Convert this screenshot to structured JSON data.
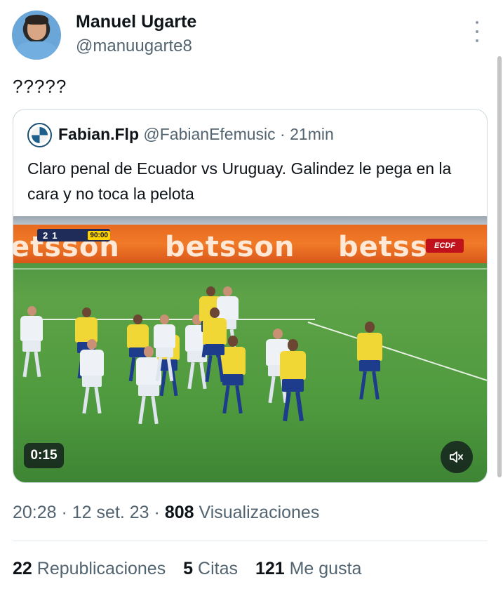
{
  "author": {
    "name": "Manuel Ugarte",
    "handle": "@manuugarte8"
  },
  "tweet": {
    "text": "?????"
  },
  "quoted": {
    "name": "Fabian.Flp",
    "handle": "@FabianEfemusic",
    "separator": " · ",
    "age": "21min",
    "text": "Claro penal de Ecuador vs Uruguay. Galindez le pega en la cara y no toca la pelota"
  },
  "video": {
    "duration": "0:15",
    "muted": true,
    "ad_banner": [
      "etsson",
      "betsson",
      "betss"
    ],
    "badge": "ECDF",
    "scorebug": {
      "home": "2",
      "away": "1",
      "clock": "90:00"
    }
  },
  "meta": {
    "time": "20:28",
    "sep1": " · ",
    "date": "12 set. 23",
    "sep2": " · ",
    "views_count": "808",
    "views_label": " Visualizaciones"
  },
  "stats": [
    {
      "count": "22",
      "label": " Republicaciones"
    },
    {
      "count": "5",
      "label": " Citas"
    },
    {
      "count": "121",
      "label": " Me gusta"
    }
  ],
  "colors": {
    "text_primary": "#0f1419",
    "text_secondary": "#536471",
    "border": "#cfd9de",
    "banner_orange": "#f07a28"
  }
}
